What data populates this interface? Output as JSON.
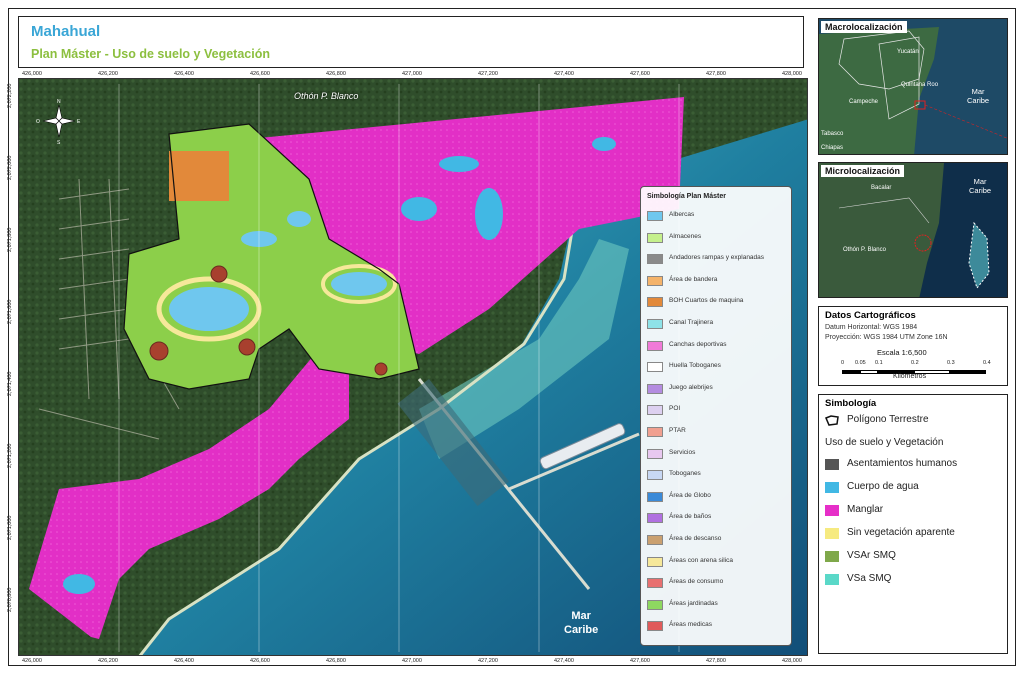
{
  "title": {
    "main": "Mahahual",
    "sub": "Plan Máster - Uso de suelo y Vegetación"
  },
  "main_map": {
    "place_label": "Othón P. Blanco",
    "sea_label_line1": "Mar",
    "sea_label_line2": "Caribe",
    "x_coords": [
      "426,000",
      "426,200",
      "426,400",
      "426,600",
      "426,800",
      "427,000",
      "427,200",
      "427,400",
      "427,600",
      "427,800",
      "428,000"
    ],
    "y_coords": [
      "2,072,200",
      "2,072,000",
      "2,071,800",
      "2,071,600",
      "2,071,400",
      "2,071,200",
      "2,071,000",
      "2,070,800"
    ],
    "colors": {
      "manglar": "#e62fc8",
      "sea": "#1f7fa0",
      "forest": "#2e4b2a",
      "land_green": "#8ccf4a"
    }
  },
  "plan_legend": {
    "title": "Simbología Plan Máster",
    "items": [
      {
        "label": "Albercas",
        "color": "#6fc7ee"
      },
      {
        "label": "Almacenes",
        "color": "#c5f08c"
      },
      {
        "label": "Andadores rampas y explanadas",
        "color": "#8a8a8a"
      },
      {
        "label": "Área de bandera",
        "color": "#f4b36a"
      },
      {
        "label": "BOH Cuartos de maquina",
        "color": "#e2893a"
      },
      {
        "label": "Canal Trajinera",
        "color": "#8ee2e8"
      },
      {
        "label": "Canchas deportivas",
        "color": "#f07ad8"
      },
      {
        "label": "Huella Toboganes",
        "color": "#ffffff"
      },
      {
        "label": "Juego alebrijes",
        "color": "#b48ce0"
      },
      {
        "label": "POI",
        "color": "#ddd0f0"
      },
      {
        "label": "PTAR",
        "color": "#f0a090"
      },
      {
        "label": "Servicios",
        "color": "#e8c8f0"
      },
      {
        "label": "Toboganes",
        "color": "#c8d8f4"
      },
      {
        "label": "Área de Globo",
        "color": "#3a8ad8"
      },
      {
        "label": "Área de baños",
        "color": "#b070e0"
      },
      {
        "label": "Área de descanso",
        "color": "#caa070"
      },
      {
        "label": "Áreas con arena silica",
        "color": "#f6e89a"
      },
      {
        "label": "Áreas de consumo",
        "color": "#e87070"
      },
      {
        "label": "Áreas jardinadas",
        "color": "#8ed860"
      },
      {
        "label": "Áreas medicas",
        "color": "#e05a5a"
      }
    ]
  },
  "macro": {
    "title": "Macrolocalización",
    "labels": [
      "Yucatán",
      "Quintana Roo",
      "Campeche",
      "Tabasco",
      "Chiapas"
    ],
    "sea_line1": "Mar",
    "sea_line2": "Caribe"
  },
  "micro": {
    "title": "Microlocalización",
    "labels": [
      "Bacalar",
      "Othón P. Blanco"
    ],
    "sea_line1": "Mar",
    "sea_line2": "Caribe"
  },
  "datos": {
    "title": "Datos Cartográficos",
    "datum": "Datum Horizontal: WGS 1984",
    "proyeccion": "Proyección: WGS 1984 UTM Zone 16N",
    "escala": "Escala 1:6,500",
    "ticks": [
      "0",
      "0.05",
      "0.1",
      "0.2",
      "0.3",
      "0.4"
    ],
    "unit": "Kilometros"
  },
  "simbologia": {
    "title": "Simbología",
    "poligono": "Polígono Terrestre",
    "uso_title": "Uso de suelo y Vegetación",
    "items": [
      {
        "label": "Asentamientos humanos",
        "color": "#555555"
      },
      {
        "label": "Cuerpo de agua",
        "color": "#41b8e4"
      },
      {
        "label": "Manglar",
        "color": "#e62fc8"
      },
      {
        "label": "Sin vegetación aparente",
        "color": "#f6ea80"
      },
      {
        "label": "VSAr SMQ",
        "color": "#7fa84a"
      },
      {
        "label": "VSa SMQ",
        "color": "#5ad8c8"
      }
    ]
  }
}
